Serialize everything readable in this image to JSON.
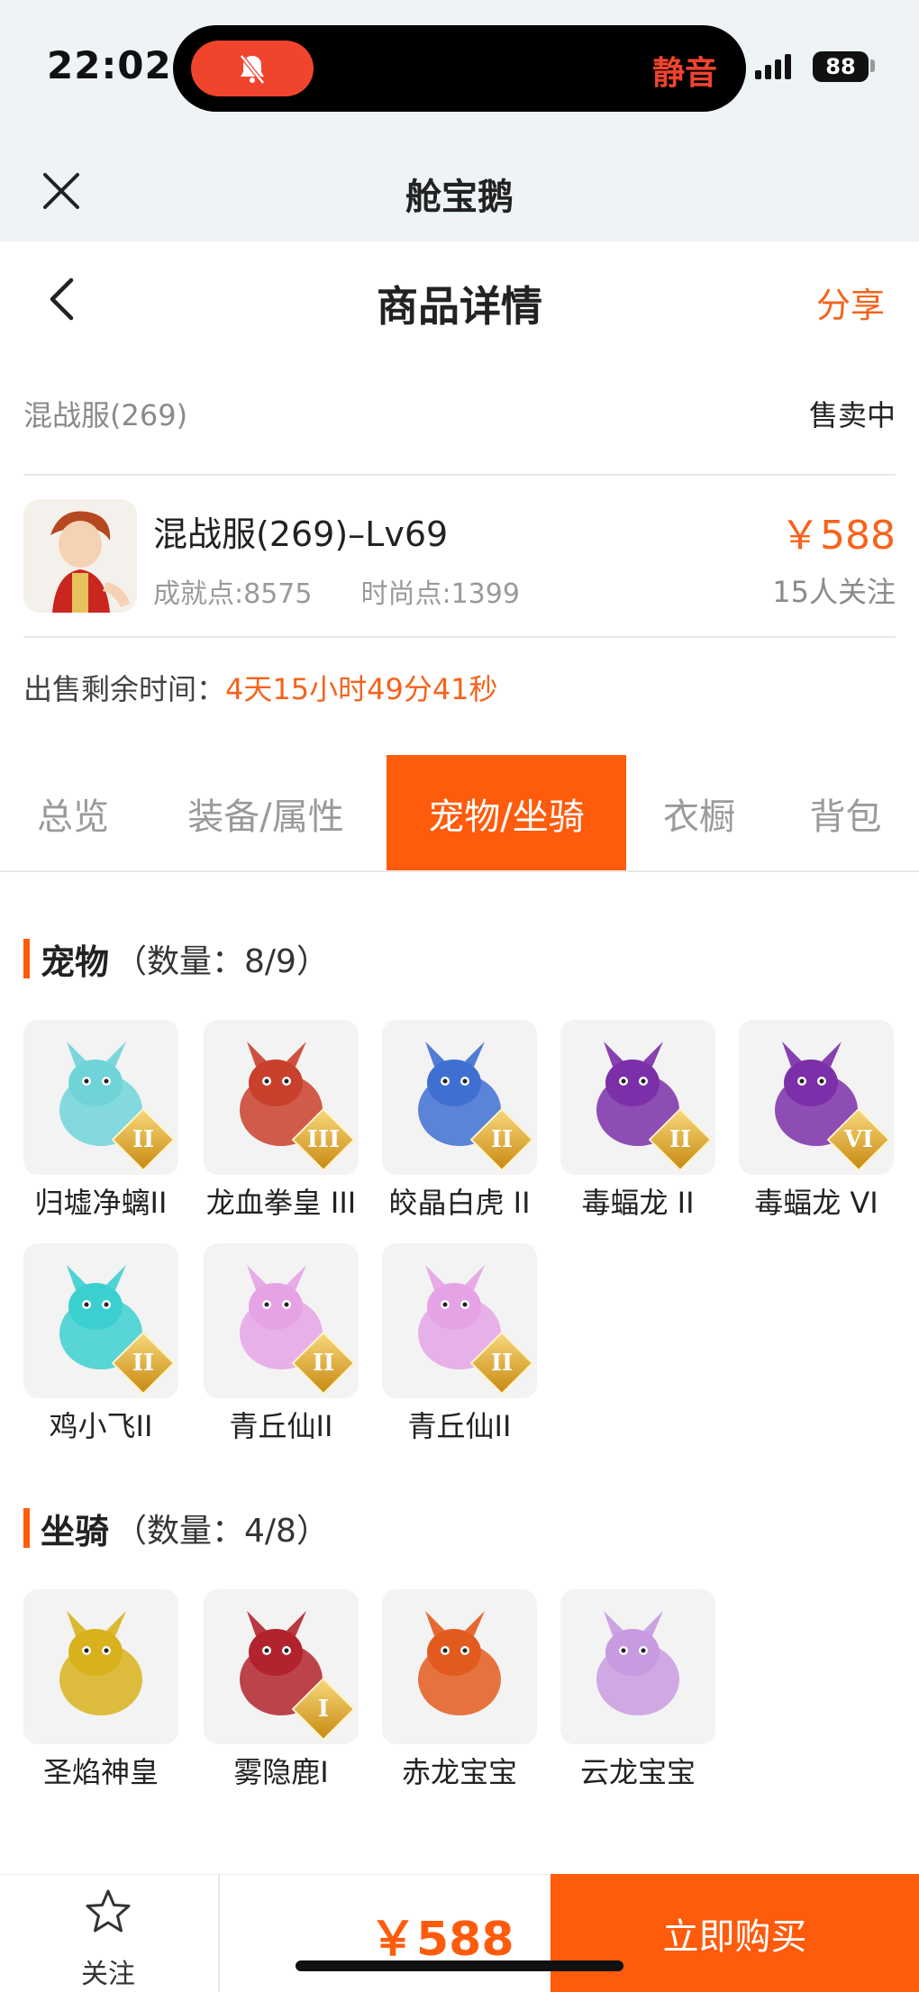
{
  "status_bar": {
    "time": "22:02",
    "mute_label": "静音",
    "battery": "88"
  },
  "app": {
    "title": "舱宝鹅"
  },
  "header": {
    "title": "商品详情",
    "share": "分享"
  },
  "listing": {
    "server": "混战服(269)",
    "status": "售卖中",
    "name": "混战服(269)–Lv69",
    "achievement": "成就点:8575",
    "fashion": "时尚点:1399",
    "price": "￥588",
    "followers": "15人关注",
    "remaining_label": "出售剩余时间：",
    "remaining_value": "4天15小时49分41秒"
  },
  "tabs": [
    "总览",
    "装备/属性",
    "宠物/坐骑",
    "衣橱",
    "背包"
  ],
  "active_tab": "宠物/坐骑",
  "pets": {
    "title": "宠物",
    "count": "（数量：8/9）",
    "items": [
      {
        "name": "归墟净螭II",
        "badge": "II",
        "icon": "azure-dragon-pet",
        "color": "#6fd3d8"
      },
      {
        "name": "龙血拳皇 III",
        "badge": "III",
        "icon": "red-horned-beast-pet",
        "color": "#c9402c"
      },
      {
        "name": "皎晶白虎 II",
        "badge": "II",
        "icon": "white-tiger-pet",
        "color": "#3f6fd1"
      },
      {
        "name": "毒蝠龙 II",
        "badge": "II",
        "icon": "purple-bat-dragon-pet",
        "color": "#7b2fa8"
      },
      {
        "name": "毒蝠龙 VI",
        "badge": "VI",
        "icon": "purple-bat-dragon-pet",
        "color": "#7b2fa8"
      },
      {
        "name": "鸡小飞II",
        "badge": "II",
        "icon": "blue-chick-pet",
        "color": "#3ccfd0"
      },
      {
        "name": "青丘仙II",
        "badge": "II",
        "icon": "fox-fairy-pet",
        "color": "#e5a3e6"
      },
      {
        "name": "青丘仙II",
        "badge": "II",
        "icon": "fox-fairy-pet",
        "color": "#e5a3e6"
      }
    ]
  },
  "mounts": {
    "title": "坐骑",
    "count": "（数量：4/8）",
    "items": [
      {
        "name": "圣焰神皇",
        "badge": "",
        "icon": "golden-phoenix-mount",
        "color": "#d8b21c"
      },
      {
        "name": "雾隐鹿I",
        "badge": "I",
        "icon": "crimson-deer-mount",
        "color": "#b3232d"
      },
      {
        "name": "赤龙宝宝",
        "badge": "",
        "icon": "red-baby-dragon-mount",
        "color": "#e35a1e"
      },
      {
        "name": "云龙宝宝",
        "badge": "",
        "icon": "cloud-baby-dragon-mount",
        "color": "#c89ae0"
      }
    ]
  },
  "bottom": {
    "follow": "关注",
    "price": "￥588",
    "buy": "立即购买"
  },
  "colors": {
    "accent": "#fe5b0c",
    "muted": "#9a9a9a",
    "header_bg": "#eef3f6"
  }
}
